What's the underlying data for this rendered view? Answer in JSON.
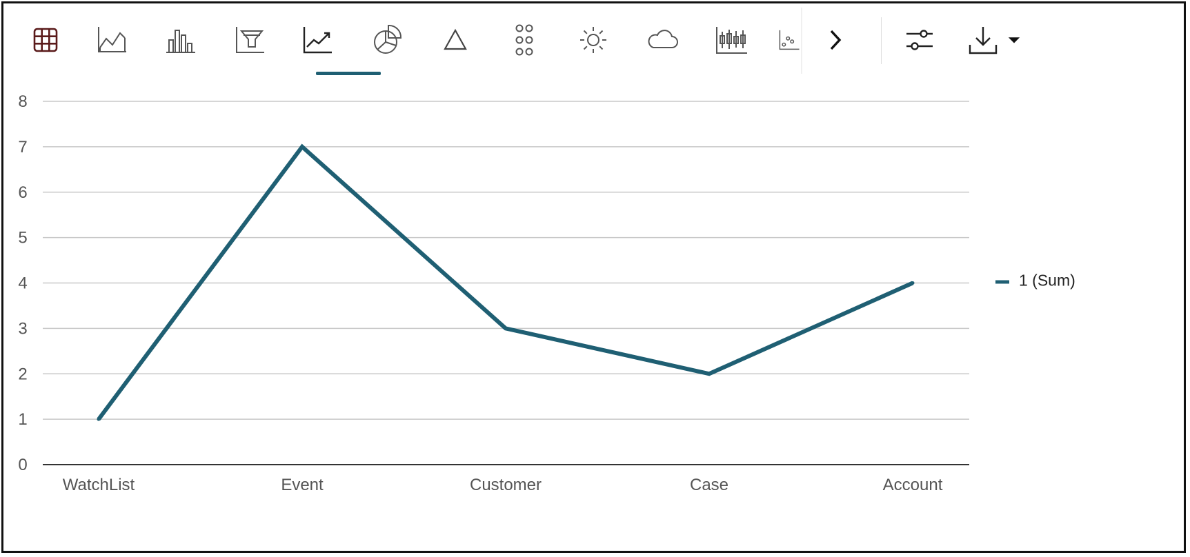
{
  "toolbar": {
    "tools": [
      {
        "name": "table-view-icon",
        "active": false
      },
      {
        "name": "area-chart-icon",
        "active": false
      },
      {
        "name": "bar-chart-icon",
        "active": false
      },
      {
        "name": "funnel-chart-icon",
        "active": false
      },
      {
        "name": "line-chart-icon",
        "active": true
      },
      {
        "name": "pie-chart-icon",
        "active": false
      },
      {
        "name": "pyramid-chart-icon",
        "active": false
      },
      {
        "name": "dot-grid-icon",
        "active": false
      },
      {
        "name": "sunburst-icon",
        "active": false
      },
      {
        "name": "tag-cloud-icon",
        "active": false
      },
      {
        "name": "stock-chart-icon",
        "active": false
      },
      {
        "name": "scatter-chart-icon",
        "active": false
      }
    ],
    "more": "chevron-right-icon",
    "settings": "settings-sliders-icon",
    "download": "download-icon",
    "download_menu": "caret-down-icon"
  },
  "colors": {
    "series": "#1f5f73",
    "grid": "#c8c8c8",
    "axis": "#333333",
    "tick_text": "#555555"
  },
  "chart_data": {
    "type": "line",
    "categories": [
      "WatchList",
      "Event",
      "Customer",
      "Case",
      "Account"
    ],
    "series": [
      {
        "name": "1 (Sum)",
        "values": [
          1,
          7,
          3,
          2,
          4
        ]
      }
    ],
    "yticks": [
      "0",
      "1",
      "2",
      "3",
      "4",
      "5",
      "6",
      "7",
      "8"
    ],
    "ylim": [
      0,
      8
    ],
    "grid": true,
    "legend_position": "right"
  }
}
